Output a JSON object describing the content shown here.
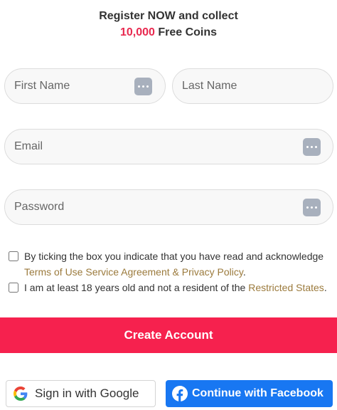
{
  "header": {
    "line1": "Register NOW and collect",
    "coins_amount": "10,000",
    "coins_label": "Free Coins"
  },
  "form": {
    "first_name": {
      "placeholder": "First Name",
      "value": ""
    },
    "last_name": {
      "placeholder": "Last Name",
      "value": ""
    },
    "email": {
      "placeholder": "Email",
      "value": ""
    },
    "password": {
      "placeholder": "Password",
      "value": ""
    }
  },
  "checkboxes": {
    "terms": {
      "text_before": "By ticking the box you indicate that you have read and acknowledge ",
      "link": "Terms of Use Service Agreement & Privacy Policy",
      "text_after": ".",
      "checked": false
    },
    "age": {
      "text_before": "I am at least 18 years old and not a resident of the ",
      "link": "Restricted States",
      "text_after": ".",
      "checked": false
    }
  },
  "buttons": {
    "create_account": "Create Account",
    "google": "Sign in with Google",
    "facebook": "Continue with Facebook"
  },
  "icons": {
    "field_icon": "keyboard-dots-icon",
    "google": "google-g-icon",
    "facebook": "facebook-f-icon"
  },
  "colors": {
    "accent": "#e8294f",
    "create_button": "#f6214e",
    "link": "#9b7a3c",
    "facebook": "#1877f2",
    "field_icon": "#a8b0bd"
  }
}
